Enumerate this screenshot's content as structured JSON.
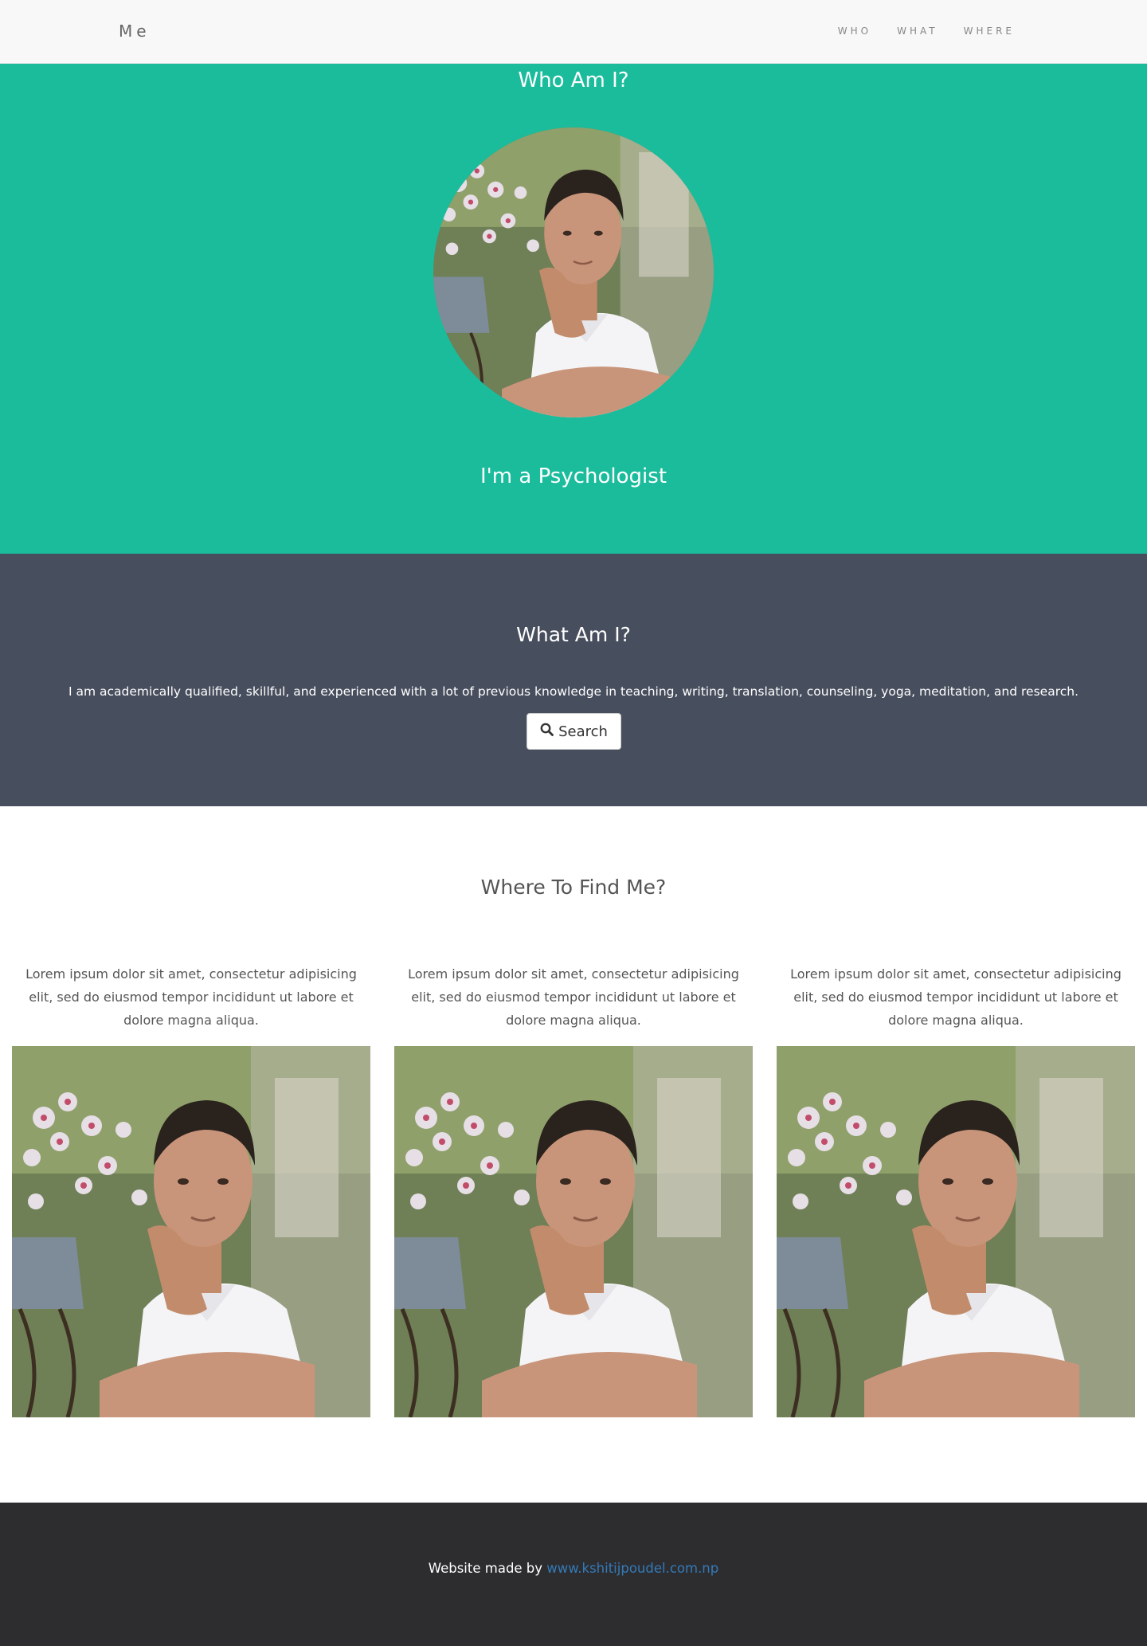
{
  "navbar": {
    "brand": "Me",
    "links": [
      "WHO",
      "WHAT",
      "WHERE"
    ]
  },
  "who": {
    "title": "Who Am I?",
    "subtitle": "I'm a Psychologist"
  },
  "what": {
    "title": "What Am I?",
    "description": "I am academically qualified, skillful, and experienced with a lot of previous knowledge in teaching, writing, translation, counseling, yoga, meditation, and research.",
    "search_label": "Search"
  },
  "where": {
    "title": "Where To Find Me?",
    "cards": [
      {
        "text": "Lorem ipsum dolor sit amet, consectetur adipisicing elit, sed do eiusmod tempor incididunt ut labore et dolore magna aliqua."
      },
      {
        "text": "Lorem ipsum dolor sit amet, consectetur adipisicing elit, sed do eiusmod tempor incididunt ut labore et dolore magna aliqua."
      },
      {
        "text": "Lorem ipsum dolor sit amet, consectetur adipisicing elit, sed do eiusmod tempor incididunt ut labore et dolore magna aliqua."
      }
    ]
  },
  "footer": {
    "prefix": "Website made by ",
    "link_text": "www.kshitijpoudel.com.np"
  },
  "colors": {
    "who_bg": "#1abc9c",
    "what_bg": "#474e5d",
    "footer_bg": "#2d2d30",
    "link": "#337ab7"
  },
  "icons": {
    "search": "search-icon"
  }
}
